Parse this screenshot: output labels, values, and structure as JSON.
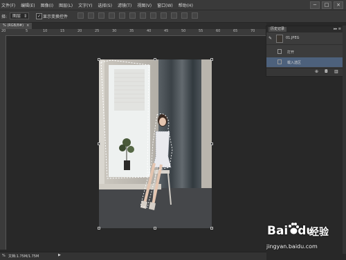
{
  "menubar": {
    "items": [
      "文件(F)",
      "编辑(E)",
      "图像(I)",
      "图层(L)",
      "文字(Y)",
      "选择(S)",
      "滤镜(T)",
      "视图(V)",
      "窗口(W)",
      "帮助(H)"
    ],
    "window_controls": [
      "−",
      "□",
      "×"
    ]
  },
  "options_bar": {
    "label": "择:",
    "select_value": "图层",
    "checkbox_checked": true,
    "checkbox_label": "显示变换控件"
  },
  "document_tab": {
    "label": "% (RGB/8#)",
    "close": "×"
  },
  "ruler_top": {
    "ticks": [
      "20",
      "5",
      "10",
      "15",
      "20",
      "25",
      "30",
      "35",
      "40",
      "45",
      "50",
      "55",
      "60",
      "65",
      "70"
    ]
  },
  "status_bar": {
    "zoom": "%",
    "doc_info": "文档:1.75M/1.75M",
    "arrow": "▶"
  },
  "history_panel": {
    "title": "历史记录",
    "controls": "▸▸ ≡",
    "snapshot_label": "01.JPEG",
    "items": [
      "打开",
      "载入选区"
    ],
    "active_index": 1
  },
  "watermark": {
    "logo": "Bai",
    "logo_suffix": "du",
    "cn": "经验",
    "url": "jingyan.baidu.com"
  },
  "colors": {
    "menubar_bg": "#3a3a3a",
    "canvas_bg": "#282828",
    "panel_bg": "#3c3c3c",
    "panel_active_row": "#4d617c",
    "accent": "#ffffff"
  }
}
